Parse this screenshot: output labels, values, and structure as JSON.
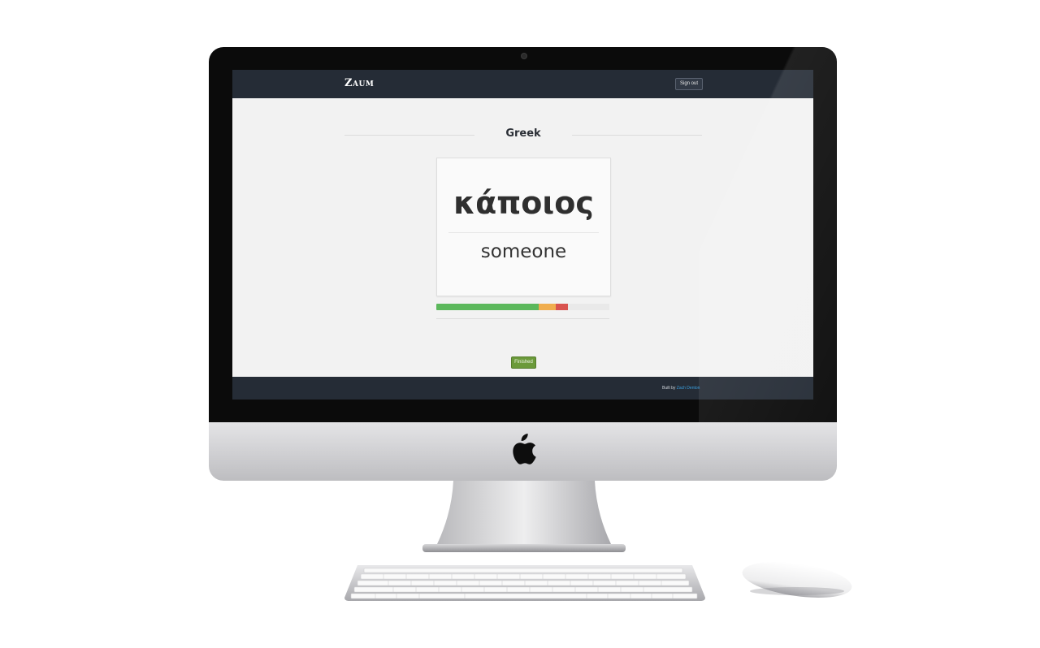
{
  "navbar": {
    "brand": "Zaum",
    "signout_label": "Sign out"
  },
  "page": {
    "title": "Greek"
  },
  "flashcard": {
    "word": "κάποιος",
    "translation": "someone"
  },
  "progress": {
    "segments": [
      {
        "status": "correct",
        "fraction": 0.59,
        "color": "#5cb85c"
      },
      {
        "status": "partial",
        "fraction": 0.1,
        "color": "#f0ad4e"
      },
      {
        "status": "incorrect",
        "fraction": 0.07,
        "color": "#d9534f"
      }
    ]
  },
  "actions": {
    "finished_label": "Finished"
  },
  "footer": {
    "built_by_label": "Built by",
    "author": "Zach Denton"
  }
}
